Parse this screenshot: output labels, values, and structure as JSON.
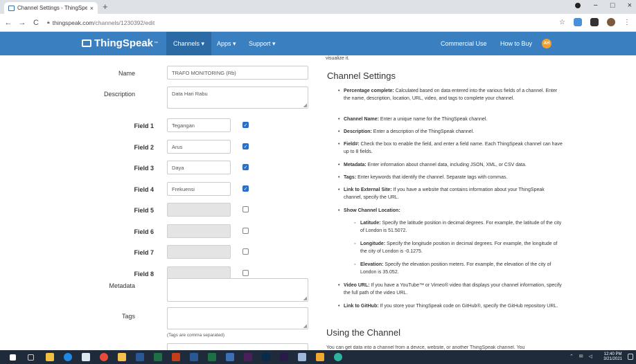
{
  "browser": {
    "tab_title": "Channel Settings - ThingSpeak I...",
    "tab_close": "×",
    "new_tab": "+",
    "url_host": "thingspeak.com",
    "url_path": "/channels/1230392/edit",
    "back": "←",
    "forward": "→",
    "reload": "C",
    "star": "☆",
    "menu_dots": "⋮",
    "minimize": "−",
    "maximize": "□",
    "close": "×"
  },
  "site_nav": {
    "logo": "ThingSpeak",
    "logo_tm": "™",
    "channels": "Channels ▾",
    "apps": "Apps ▾",
    "support": "Support ▾",
    "commercial_use": "Commercial Use",
    "how_to_buy": "How to Buy",
    "avatar_initials": "AH"
  },
  "form": {
    "name_label": "Name",
    "name_value": "TRAFO MONITORING (Rb)",
    "description_label": "Description",
    "description_value": "Data Hari Rabu",
    "fields": [
      {
        "label": "Field 1",
        "value": "Tegangan",
        "checked": true
      },
      {
        "label": "Field 2",
        "value": "Arus",
        "checked": true
      },
      {
        "label": "Field 3",
        "value": "Daya",
        "checked": true
      },
      {
        "label": "Field 4",
        "value": "Frekuensi",
        "checked": true
      },
      {
        "label": "Field 5",
        "value": "",
        "checked": false
      },
      {
        "label": "Field 6",
        "value": "",
        "checked": false
      },
      {
        "label": "Field 7",
        "value": "",
        "checked": false
      },
      {
        "label": "Field 8",
        "value": "",
        "checked": false
      }
    ],
    "metadata_label": "Metadata",
    "tags_label": "Tags",
    "tags_hint": "(Tags are comma separated)"
  },
  "help": {
    "top_cut": "visualize it.",
    "heading": "Channel Settings",
    "items": [
      {
        "term": "Percentage complete:",
        "text": " Calculated based on data entered into the various fields of a channel. Enter the name, description, location, URL, video, and tags to complete your channel."
      },
      {
        "term": "Channel Name:",
        "text": " Enter a unique name for the ThingSpeak channel."
      },
      {
        "term": "Description:",
        "text": " Enter a description of the ThingSpeak channel."
      },
      {
        "term": "Field#:",
        "text": " Check the box to enable the field, and enter a field name. Each ThingSpeak channel can have up to 8 fields."
      },
      {
        "term": "Metadata:",
        "text": " Enter information about channel data, including JSON, XML, or CSV data."
      },
      {
        "term": "Tags:",
        "text": " Enter keywords that identify the channel. Separate tags with commas."
      },
      {
        "term": "Link to External Site:",
        "text": " If you have a website that contains information about your ThingSpeak channel, specify the URL."
      },
      {
        "term": "Show Channel Location:",
        "text": ""
      }
    ],
    "sub_items": [
      {
        "term": "Latitude:",
        "text": " Specify the latitude position in decimal degrees. For example, the latitude of the city of London is 51.5072."
      },
      {
        "term": "Longitude:",
        "text": " Specify the longitude position in decimal degrees. For example, the longitude of the city of London is -0.1275."
      },
      {
        "term": "Elevation:",
        "text": " Specify the elevation position meters. For example, the elevation of the city of London is 35.052."
      }
    ],
    "items2": [
      {
        "term": "Video URL:",
        "text": " If you have a YouTube™ or Vimeo® video that displays your channel information, specify the full path of the video URL."
      },
      {
        "term": "Link to GitHub:",
        "text": " If you store your ThingSpeak code on GitHub®, specify the GitHub repository URL."
      }
    ],
    "heading2": "Using the Channel",
    "bottom_cut": "You can get data into a channel from a device, website, or another ThingSpeak channel. You"
  },
  "taskbar": {
    "time": "12:40 PM",
    "date": "3/21/2021",
    "tray": "⌃ ✉ ◁"
  },
  "colors": {
    "nav_blue": "#3a7fbf",
    "nav_active": "#2c6aa6",
    "checkbox_blue": "#2a6ec8",
    "taskbar": "#1f2b3a"
  }
}
